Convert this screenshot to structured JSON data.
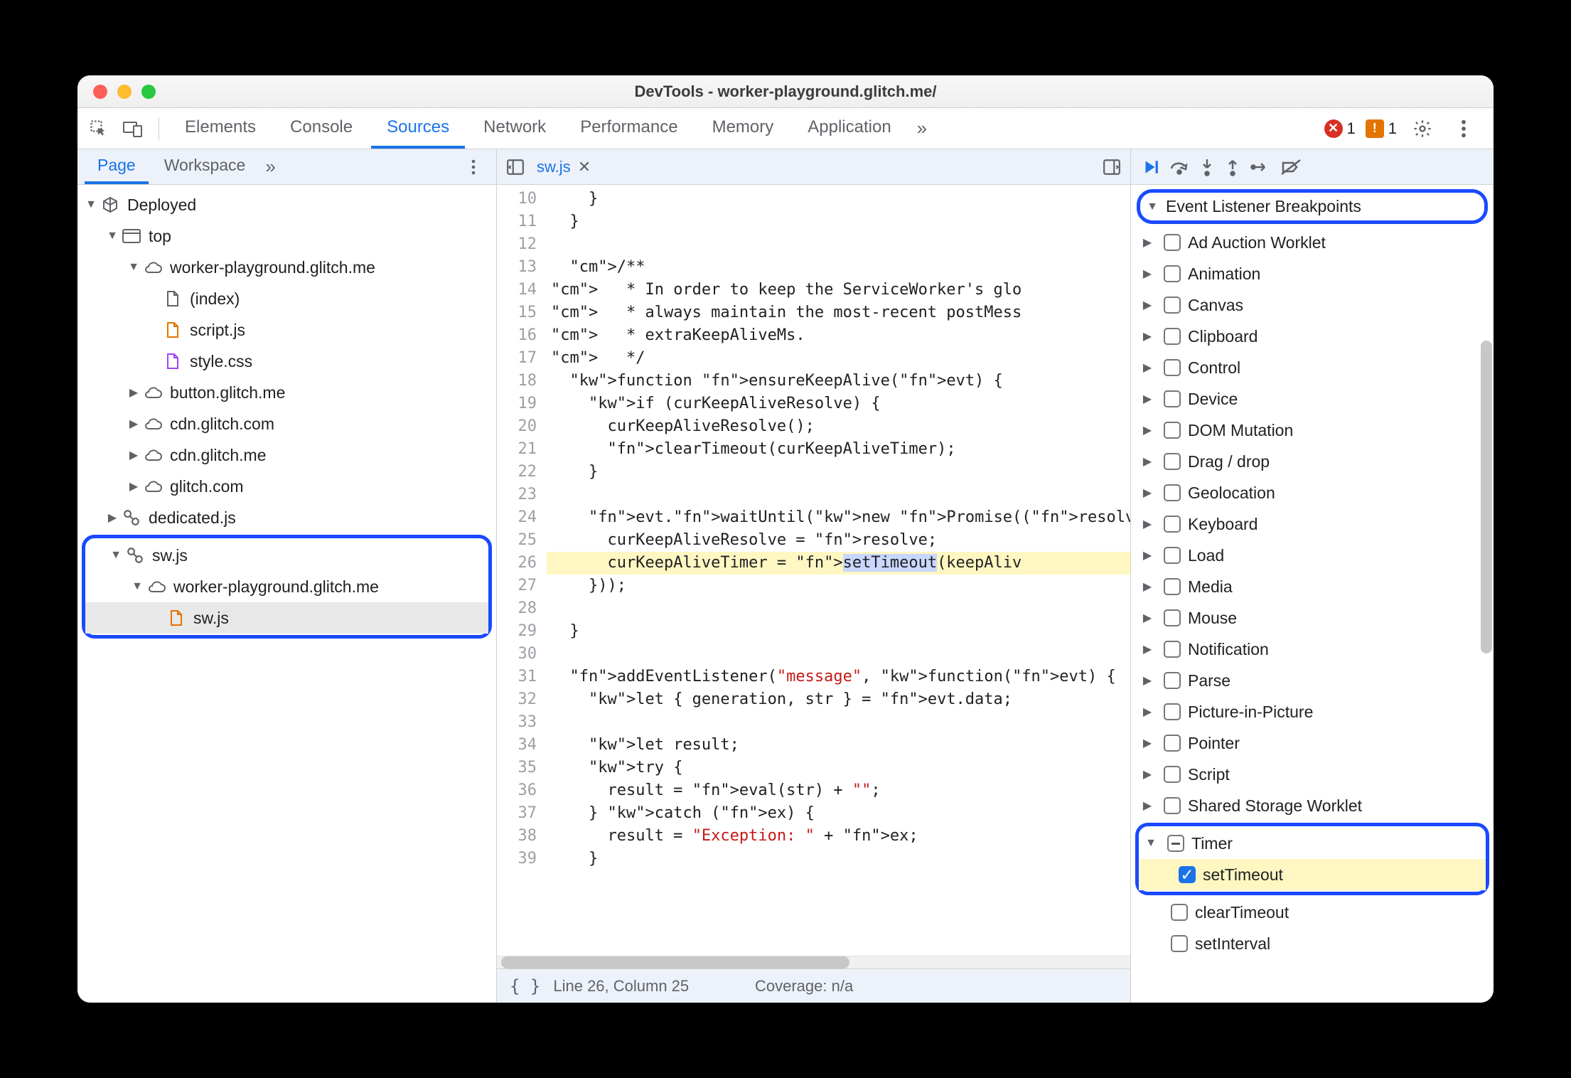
{
  "titlebar": {
    "title": "DevTools - worker-playground.glitch.me/"
  },
  "maintabs": {
    "items": [
      "Elements",
      "Console",
      "Sources",
      "Network",
      "Performance",
      "Memory",
      "Application"
    ],
    "active": "Sources",
    "overflow": "»",
    "errors_count": "1",
    "warnings_count": "1"
  },
  "left": {
    "tabs": {
      "items": [
        "Page",
        "Workspace"
      ],
      "active": "Page",
      "overflow": "»"
    },
    "tree": {
      "deployed": "Deployed",
      "top": "top",
      "domain1": "worker-playground.glitch.me",
      "file_index": "(index)",
      "file_script": "script.js",
      "file_style": "style.css",
      "domain2": "button.glitch.me",
      "domain3": "cdn.glitch.com",
      "domain4": "cdn.glitch.me",
      "domain5": "glitch.com",
      "dedicated": "dedicated.js",
      "sw": "sw.js",
      "sw_domain": "worker-playground.glitch.me",
      "sw_file": "sw.js"
    }
  },
  "center": {
    "tab_label": "sw.js",
    "line_start": 10,
    "lines": [
      "    }",
      "  }",
      "",
      "  /**",
      "   * In order to keep the ServiceWorker's glo",
      "   * always maintain the most-recent postMess",
      "   * extraKeepAliveMs.",
      "   */",
      "  function ensureKeepAlive(evt) {",
      "    if (curKeepAliveResolve) {",
      "      curKeepAliveResolve();",
      "      clearTimeout(curKeepAliveTimer);",
      "    }",
      "",
      "    evt.waitUntil(new Promise((resolve) => {",
      "      curKeepAliveResolve = resolve;",
      "      curKeepAliveTimer = setTimeout(keepAliv",
      "    }));",
      "",
      "  }",
      "",
      "  addEventListener(\"message\", function(evt) {",
      "    let { generation, str } = evt.data;",
      "",
      "    let result;",
      "    try {",
      "      result = eval(str) + \"\";",
      "    } catch (ex) {",
      "      result = \"Exception: \" + ex;",
      "    }"
    ],
    "status_left": "Line 26, Column 25",
    "status_right": "Coverage: n/a"
  },
  "right": {
    "header": "Event Listener Breakpoints",
    "categories": [
      "Ad Auction Worklet",
      "Animation",
      "Canvas",
      "Clipboard",
      "Control",
      "Device",
      "DOM Mutation",
      "Drag / drop",
      "Geolocation",
      "Keyboard",
      "Load",
      "Media",
      "Mouse",
      "Notification",
      "Parse",
      "Picture-in-Picture",
      "Pointer",
      "Script",
      "Shared Storage Worklet"
    ],
    "timer": {
      "label": "Timer",
      "children": [
        {
          "label": "setTimeout",
          "checked": true
        },
        {
          "label": "clearTimeout",
          "checked": false
        },
        {
          "label": "setInterval",
          "checked": false
        }
      ]
    }
  }
}
